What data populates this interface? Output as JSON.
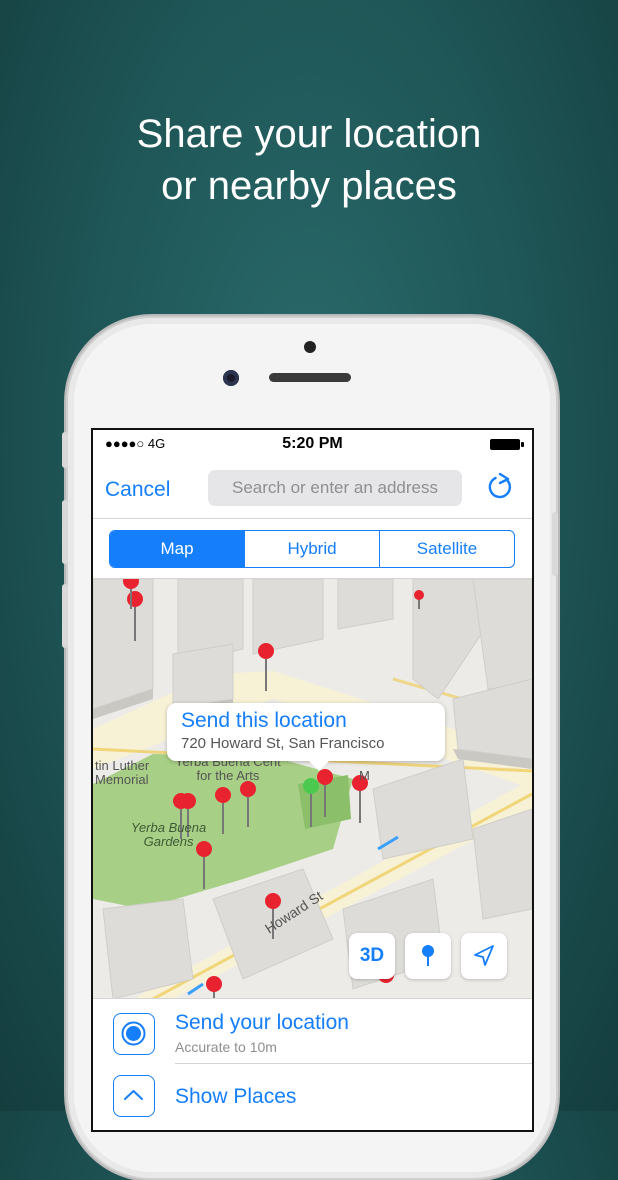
{
  "headline": {
    "line1": "Share your location",
    "line2": "or nearby places"
  },
  "status_bar": {
    "signal": "●●●●○ 4G",
    "time": "5:20 PM"
  },
  "nav": {
    "cancel_label": "Cancel",
    "search_placeholder": "Search or enter an address",
    "refresh_icon": "refresh-icon"
  },
  "segmented": {
    "tabs": [
      {
        "label": "Map",
        "active": true
      },
      {
        "label": "Hybrid",
        "active": false
      },
      {
        "label": "Satellite",
        "active": false
      }
    ]
  },
  "map": {
    "callout_title": "Send this location",
    "callout_address": "720 Howard St, San Francisco",
    "labels": {
      "mlk": "tin Luther\nMemorial",
      "yerba_center": "Yerba Buena Cent\nfor the Arts",
      "gardens": "Yerba Buena\nGardens",
      "howard": "Howard St",
      "m_label": "M"
    },
    "controls": {
      "three_d": "3D",
      "pin_icon": "pin-icon",
      "location_icon": "location-arrow-icon"
    }
  },
  "bottom": {
    "send_title": "Send your location",
    "send_sub": "Accurate to 10m",
    "places_title": "Show Places"
  },
  "colors": {
    "accent": "#157efb",
    "pin_red": "#e8232f",
    "pin_green": "#4cc94f",
    "background": "#1e5455"
  }
}
